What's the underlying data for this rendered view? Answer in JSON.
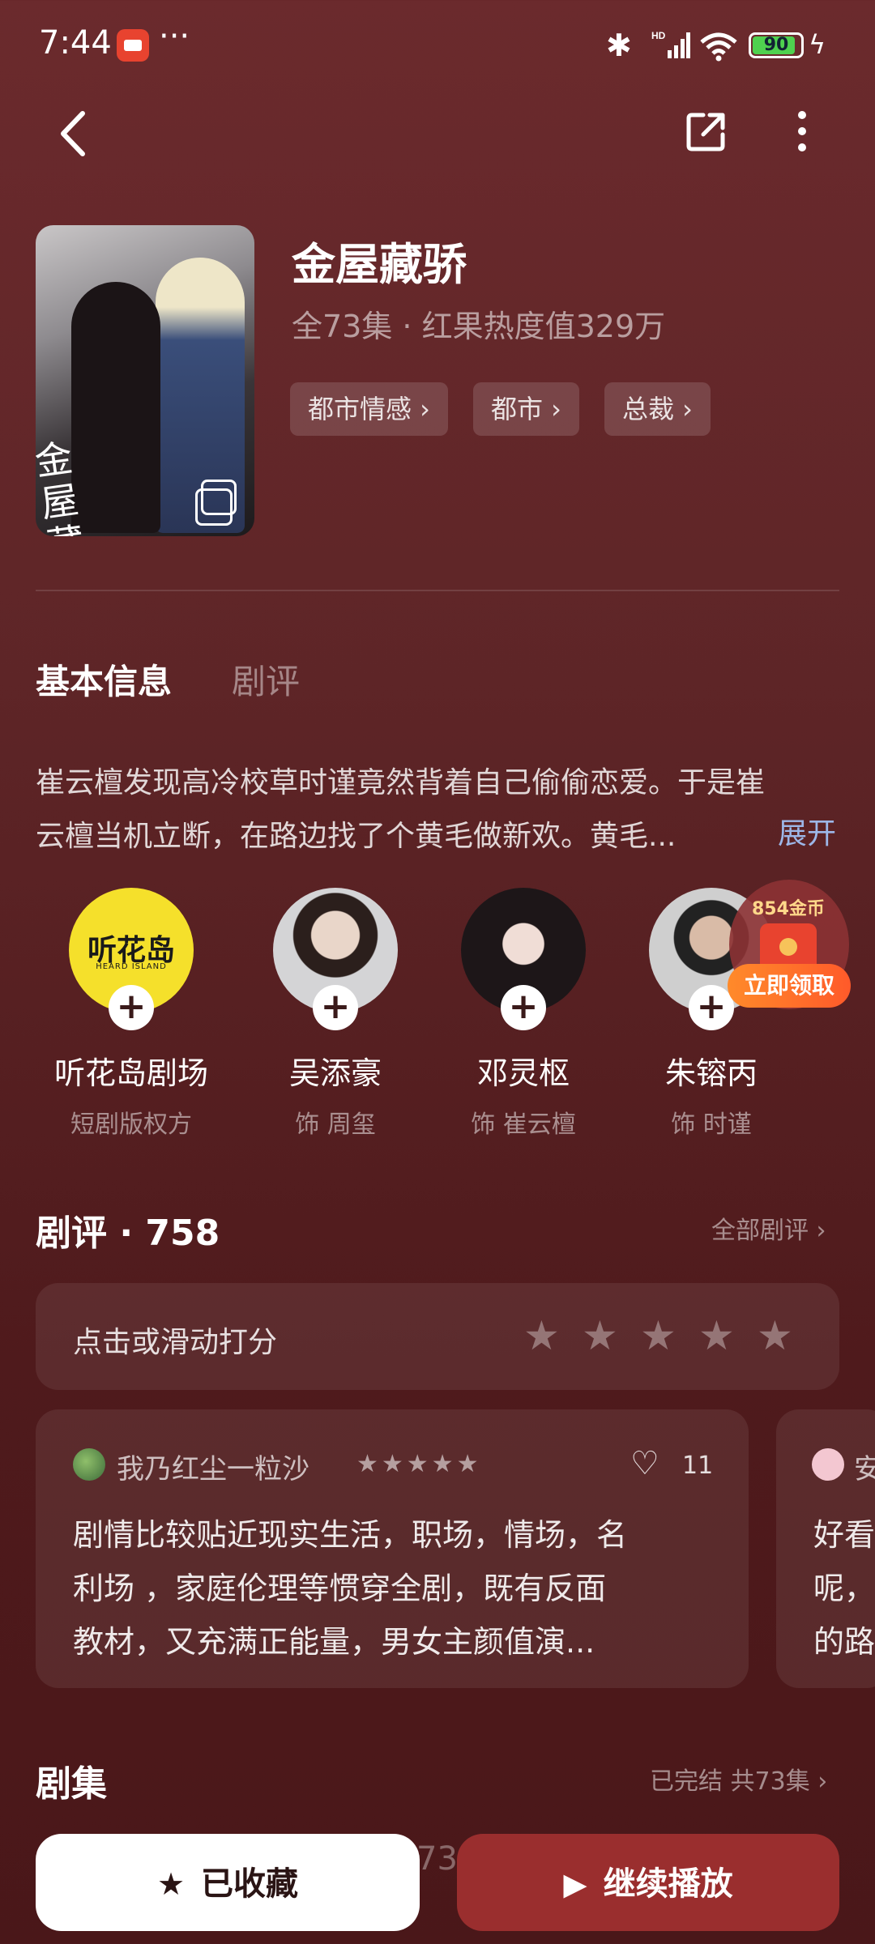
{
  "status_bar": {
    "time": "7:44",
    "dots": "···",
    "battery": "90",
    "battery_fraction": 0.9,
    "network": "HD"
  },
  "drama": {
    "title": "金屋藏骄",
    "meta": "全73集 · 红果热度值329万",
    "cover_text": "金屋藏骄",
    "tags": [
      "都市情感 ›",
      "都市 ›",
      "总裁 ›"
    ]
  },
  "tabs": [
    "基本信息",
    "剧评"
  ],
  "synopsis": {
    "line1": "崔云檀发现高冷校草时谨竟然背着自己偷偷恋爱。于是崔",
    "line2": "云檀当机立断，在路边找了个黄毛做新欢。黄毛...",
    "expand_label": "展开"
  },
  "cast": [
    {
      "name": "听花岛剧场",
      "role": "短剧版权方",
      "logo": "听花岛",
      "logo_sub": "HEARD ISLAND"
    },
    {
      "name": "吴添豪",
      "role": "饰 周玺"
    },
    {
      "name": "邓灵枢",
      "role": "饰 崔云檀"
    },
    {
      "name": "朱镕丙",
      "role": "饰 时谨"
    }
  ],
  "coin_promo": {
    "amount": "854金币",
    "claim_label": "立即领取"
  },
  "reviews": {
    "title": "剧评 · 758",
    "all_label": "全部剧评 ›",
    "rate_prompt": "点击或滑动打分",
    "items": [
      {
        "user": "我乃红尘一粒沙",
        "rating": 5,
        "likes": "11",
        "line1": "剧情比较贴近现实生活，职场，情场，名",
        "line2": "利场 ，家庭伦理等惯穿全剧，既有反面",
        "line3": "教材，又充满正能量，男女主颜值演..."
      },
      {
        "user": "安",
        "line1": "好看",
        "line2": "呢，",
        "line3": "的路"
      }
    ]
  },
  "episodes": {
    "title": "剧集",
    "status": "已完结 共73集 ›",
    "peek": "73"
  },
  "bottom_bar": {
    "favorite_label": "已收藏",
    "play_label": "继续播放"
  },
  "colors": {
    "background": "#5e2527",
    "accent_link": "#9db7e8",
    "play_button": "#9a2e2e",
    "claim_button": "#ff6a2a"
  }
}
